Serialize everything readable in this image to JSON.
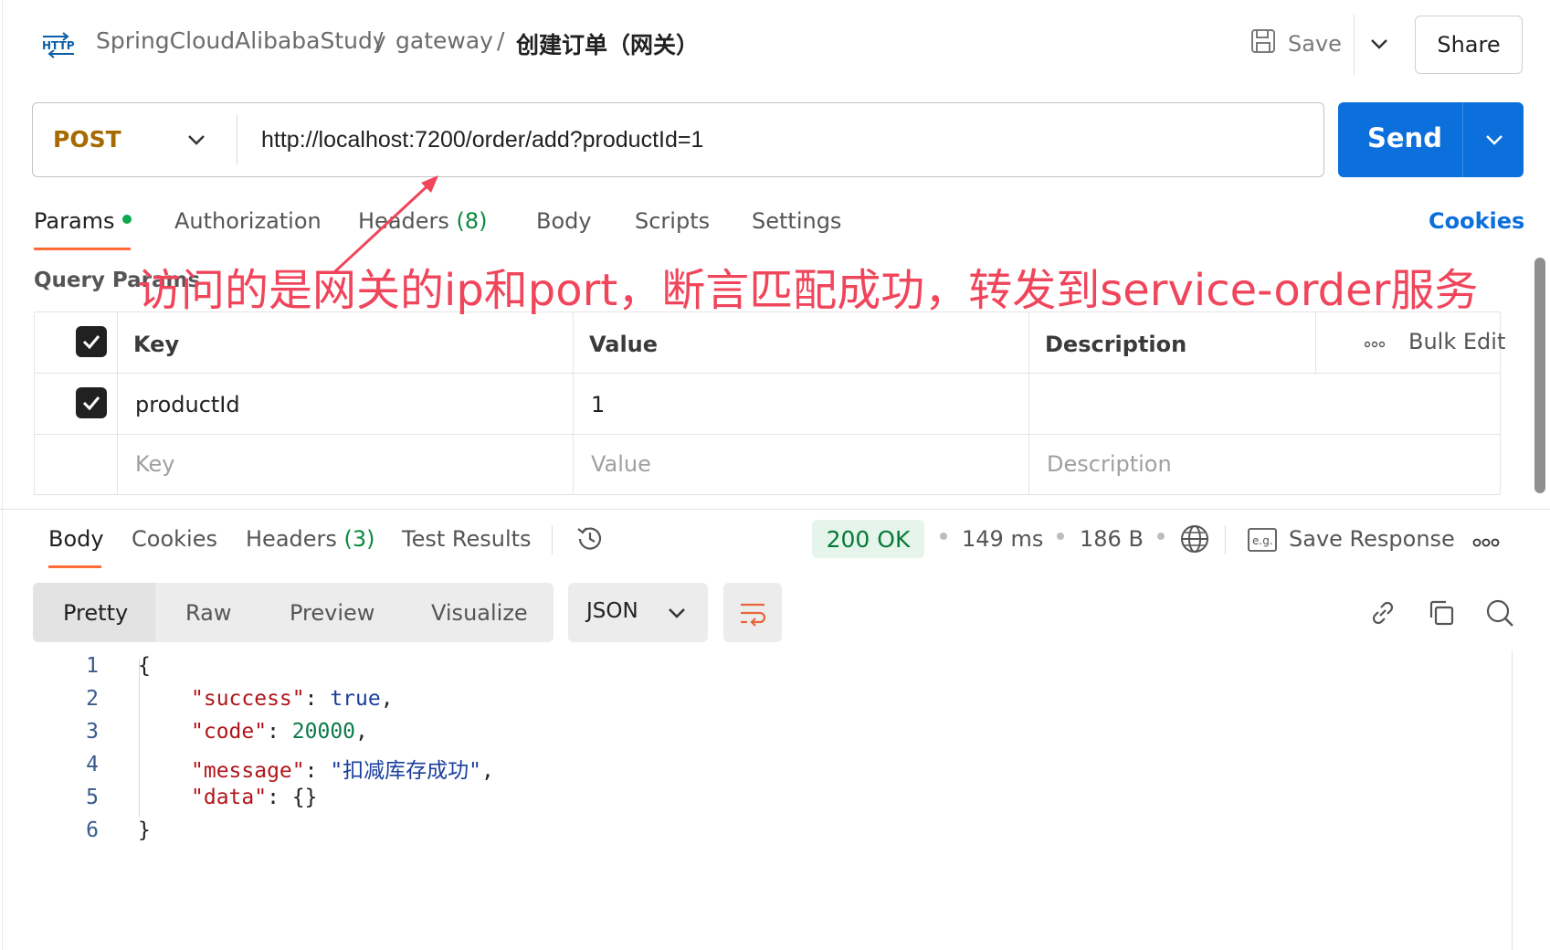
{
  "header": {
    "protocol_icon": "http-icon",
    "breadcrumb": [
      "SpringCloudAlibabaStudy",
      "gateway",
      "创建订单（网关）"
    ],
    "separator": "/",
    "save_label": "Save",
    "share_label": "Share"
  },
  "request": {
    "method": "POST",
    "url": "http://localhost:7200/order/add?productId=1",
    "send_label": "Send"
  },
  "request_tabs": {
    "params": "Params",
    "authorization": "Authorization",
    "headers": "Headers",
    "headers_count": "(8)",
    "body": "Body",
    "scripts": "Scripts",
    "settings": "Settings",
    "cookies": "Cookies"
  },
  "query_params": {
    "title": "Query Params",
    "columns": {
      "key": "Key",
      "value": "Value",
      "description": "Description"
    },
    "bulk_edit": "Bulk Edit",
    "rows": [
      {
        "key": "productId",
        "value": "1",
        "description": "",
        "checked": true
      }
    ],
    "placeholder": {
      "key": "Key",
      "value": "Value",
      "description": "Description"
    }
  },
  "annotation": {
    "text": "访问的是网关的ip和port，断言匹配成功，转发到service-order服务",
    "color": "#f0455b"
  },
  "response": {
    "tabs": {
      "body": "Body",
      "cookies": "Cookies",
      "headers": "Headers",
      "headers_count": "(3)",
      "test_results": "Test Results"
    },
    "status": "200 OK",
    "time": "149 ms",
    "size": "186 B",
    "save_response": "Save Response",
    "views": [
      "Pretty",
      "Raw",
      "Preview",
      "Visualize"
    ],
    "format": "JSON",
    "lines": {
      "l1": "{",
      "success_key": "\"success\"",
      "success_val": "true",
      "code_key": "\"code\"",
      "code_val": "20000",
      "message_key": "\"message\"",
      "message_val": "\"扣减库存成功\"",
      "data_key": "\"data\"",
      "data_val": "{}",
      "l6": "}"
    },
    "line_numbers": [
      "1",
      "2",
      "3",
      "4",
      "5",
      "6"
    ]
  },
  "colors": {
    "send": "#0b6fdc",
    "method": "#a56a00",
    "status_bg": "#e6f5ec",
    "status_fg": "#077a36",
    "accent_tab": "#ff6c37"
  }
}
